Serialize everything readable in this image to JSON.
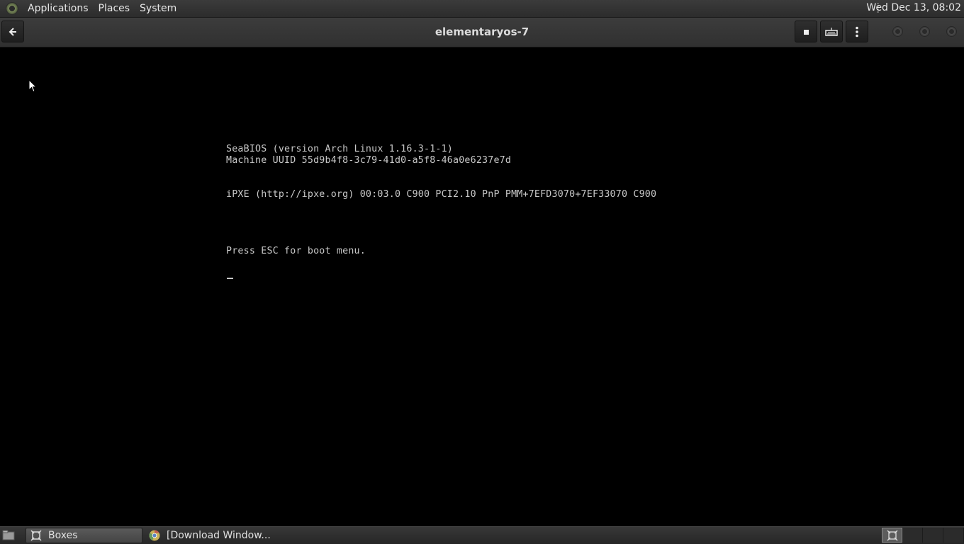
{
  "top_panel": {
    "menus": [
      "Applications",
      "Places",
      "System"
    ],
    "clock": "Wed Dec 13, 08:02"
  },
  "headerbar": {
    "title": "elementaryos-7"
  },
  "vm_console": {
    "lines": [
      "SeaBIOS (version Arch Linux 1.16.3-1-1)",
      "Machine UUID 55d9b4f8-3c79-41d0-a5f8-46a0e6237e7d",
      "iPXE (http://ipxe.org) 00:03.0 C900 PCI2.10 PnP PMM+7EFD3070+7EF33070 C900",
      "Press ESC for boot menu."
    ]
  },
  "taskbar": {
    "tasks": [
      {
        "label": "Boxes",
        "icon": "boxes-icon",
        "active": true
      },
      {
        "label": "[Download Window...",
        "icon": "chrome-icon",
        "active": false
      }
    ],
    "workspaces": 4
  },
  "colors": {
    "panel_bg": "#2f2f2f",
    "console_text": "#c8c8c8",
    "console_bg": "#000000"
  }
}
